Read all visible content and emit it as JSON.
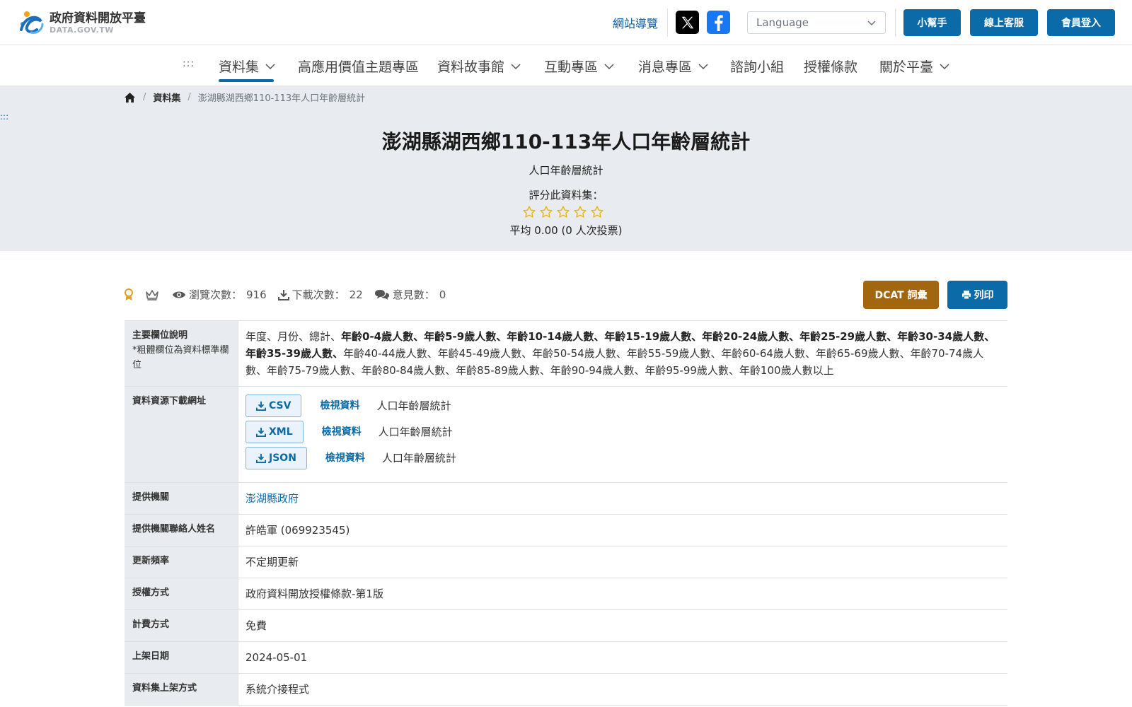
{
  "header": {
    "logo_name": "政府資料開放平臺",
    "logo_sub": "DATA.GOV.TW",
    "site_nav": "網站導覽",
    "language_placeholder": "Language",
    "helper_btn": "小幫手",
    "service_btn": "線上客服",
    "login_btn": "會員登入"
  },
  "nav": {
    "accesskey": ":::",
    "items": [
      {
        "label": "資料集",
        "dropdown": true,
        "active": true
      },
      {
        "label": "高應用價值主題專區",
        "dropdown": false
      },
      {
        "label": "資料故事館",
        "dropdown": true
      },
      {
        "label": "互動專區",
        "dropdown": true
      },
      {
        "label": "消息專區",
        "dropdown": true
      },
      {
        "label": "諮詢小組",
        "dropdown": false
      },
      {
        "label": "授權條款",
        "dropdown": false
      },
      {
        "label": "關於平臺",
        "dropdown": true
      }
    ]
  },
  "breadcrumb": {
    "section": "資料集",
    "current": "澎湖縣湖西鄉110-113年人口年齡層統計"
  },
  "hero": {
    "accesskey": ":::",
    "title": "澎湖縣湖西鄉110-113年人口年齡層統計",
    "subtitle": "人口年齡層統計",
    "rate_label": "評分此資料集：",
    "rating": 0,
    "max_rating": 5,
    "average": "平均 0.00 (0 人次投票)"
  },
  "stats": {
    "views_label": "瀏覽次數：",
    "views": "916",
    "downloads_label": "下載次數：",
    "downloads": "22",
    "comments_label": "意見數：",
    "comments": "0",
    "dcat_btn": "DCAT 詞彙",
    "print_btn": "列印"
  },
  "table": {
    "fields_label": "主要欄位說明",
    "fields_note": "*粗體欄位為資料標準欄位",
    "fields_plain_1": "年度、月份、總計、",
    "fields_bold": "年齡0-4歲人數、年齡5-9歲人數、年齡10-14歲人數、年齡15-19歲人數、年齡20-24歲人數、年齡25-29歲人數、年齡30-34歲人數、年齡35-39歲人數、",
    "fields_plain_2": "年齡40-44歲人數、年齡45-49歲人數、年齡50-54歲人數、年齡55-59歲人數、年齡60-64歲人數、年齡65-69歲人數、年齡70-74歲人數、年齡75-79歲人數、年齡80-84歲人數、年齡85-89歲人數、年齡90-94歲人數、年齡95-99歲人數、年齡100歲人數以上",
    "resources_label": "資料資源下載網址",
    "resources": [
      {
        "format": "CSV",
        "view": "檢視資料",
        "name": "人口年齡層統計"
      },
      {
        "format": "XML",
        "view": "檢視資料",
        "name": "人口年齡層統計"
      },
      {
        "format": "JSON",
        "view": "檢視資料",
        "name": "人口年齡層統計"
      }
    ],
    "agency_label": "提供機關",
    "agency": "澎湖縣政府",
    "contact_label": "提供機關聯絡人姓名",
    "contact": "許皓軍 (069923545)",
    "frequency_label": "更新頻率",
    "frequency": "不定期更新",
    "license_label": "授權方式",
    "license": "政府資料開放授權條款-第1版",
    "fee_label": "計費方式",
    "fee": "免費",
    "date_label": "上架日期",
    "date": "2024-05-01",
    "method_label": "資料集上架方式",
    "method": "系統介接程式"
  },
  "colors": {
    "primary": "#0b6ba8",
    "dcat": "#a1660e",
    "hero_bg": "#e8ebef",
    "star": "#e8b400"
  }
}
